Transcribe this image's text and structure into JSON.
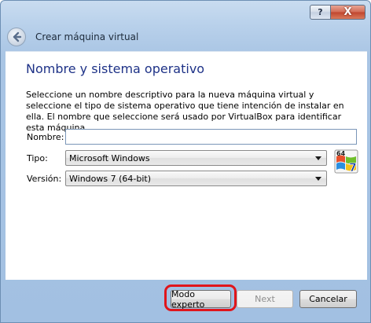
{
  "window": {
    "help_glyph": "?",
    "close_glyph": "X"
  },
  "header": {
    "title": "Crear máquina virtual",
    "back_icon": "back-arrow-icon"
  },
  "page": {
    "title": "Nombre y sistema operativo",
    "description": "Seleccione un nombre descriptivo para la nueva máquina virtual y seleccione el tipo de sistema operativo que tiene intención de instalar en ella. El nombre que seleccione será usado por VirtualBox para identificar esta máquina."
  },
  "form": {
    "name_label": "Nombre:",
    "name_value": "",
    "type_label": "Tipo:",
    "type_value": "Microsoft Windows",
    "version_label": "Versión:",
    "version_value": "Windows 7 (64-bit)",
    "os_icon": "windows-7-64-icon",
    "os_icon_badge": "64",
    "os_icon_number": "7"
  },
  "footer": {
    "expert_label": "Modo experto",
    "next_label": "Next",
    "cancel_label": "Cancelar"
  },
  "colors": {
    "title_blue": "#1e3287",
    "highlight_red": "#e0151b"
  }
}
